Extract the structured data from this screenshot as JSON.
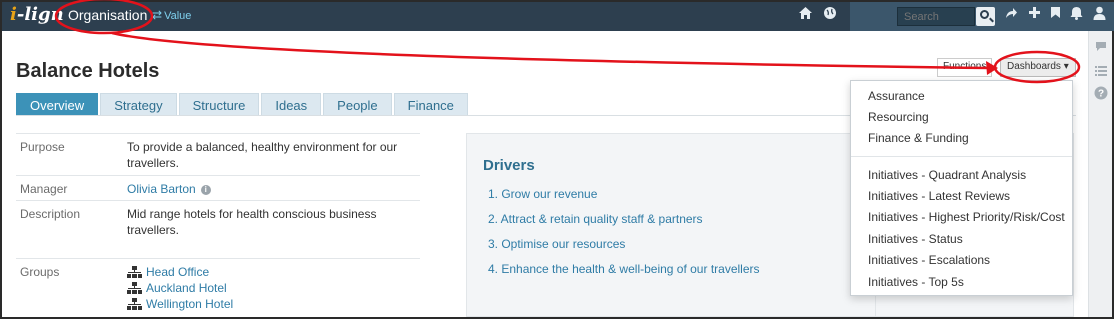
{
  "header": {
    "logo_prefix": "i",
    "logo_rest": "-lign",
    "organisation_link": "Organisation",
    "value_link": "Value",
    "search_placeholder": "Search"
  },
  "icons": {
    "home": "home-icon",
    "globe": "globe-icon",
    "share": "share-icon",
    "add": "plus-icon",
    "bookmark": "bookmark-icon",
    "notifications": "bell-icon",
    "user": "user-icon",
    "chat": "chat-icon",
    "list": "list-icon",
    "help": "help-icon",
    "switch": "swap-arrows-icon"
  },
  "page": {
    "title": "Balance Hotels",
    "functions_label": "Functions",
    "dashboards_label": "Dashboards ▾"
  },
  "tabs": [
    {
      "label": "Overview",
      "active": true
    },
    {
      "label": "Strategy"
    },
    {
      "label": "Structure"
    },
    {
      "label": "Ideas"
    },
    {
      "label": "People"
    },
    {
      "label": "Finance"
    }
  ],
  "details": {
    "purpose_label": "Purpose",
    "purpose_value": "To provide a balanced, healthy environment for our travellers.",
    "manager_label": "Manager",
    "manager_value": "Olivia Barton",
    "description_label": "Description",
    "description_value": "Mid range hotels for health conscious business travellers.",
    "groups_label": "Groups",
    "groups": [
      "Head Office",
      "Auckland Hotel",
      "Wellington Hotel"
    ]
  },
  "drivers": {
    "title": "Drivers",
    "items": [
      "1. Grow our revenue",
      "2. Attract & retain quality staff & partners",
      "3. Optimise our resources",
      "4. Enhance the health & well-being of our travellers"
    ]
  },
  "dashboards_menu": {
    "group1": [
      "Assurance",
      "Resourcing",
      "Finance & Funding"
    ],
    "group2": [
      "Initiatives - Quadrant Analysis",
      "Initiatives - Latest Reviews",
      "Initiatives - Highest Priority/Risk/Cost",
      "Initiatives - Status",
      "Initiatives - Escalations",
      "Initiatives - Top 5s"
    ]
  },
  "colors": {
    "topbar": "#2d3f4f",
    "accent": "#3c92b8",
    "link": "#2f7ca6",
    "annotation": "#e3121b"
  }
}
